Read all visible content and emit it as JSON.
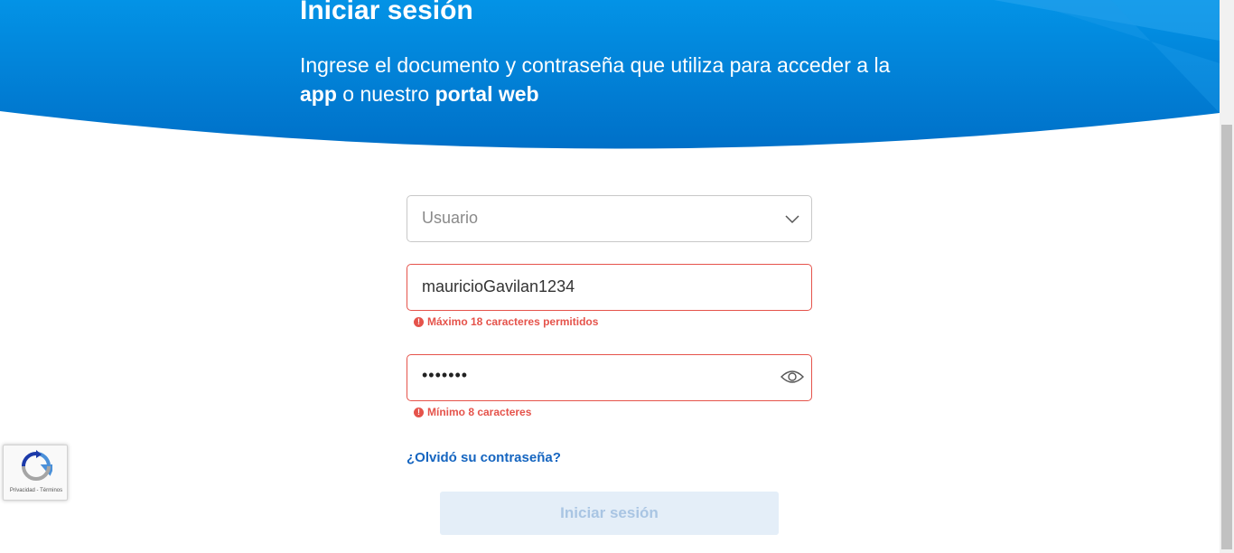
{
  "hero": {
    "title": "Iniciar sesión",
    "subtitle_part1": "Ingrese el documento y contraseña que utiliza para acceder a la ",
    "subtitle_bold1": "app",
    "subtitle_part2": " o nuestro ",
    "subtitle_bold2": "portal web"
  },
  "form": {
    "user_type_placeholder": "Usuario",
    "username_value": "mauricioGavilan1234",
    "username_error": "Máximo 18 caracteres permitidos",
    "password_masked": "•••••••",
    "password_error": "Mínimo 8 caracteres",
    "forgot_link": "¿Olvidó su contraseña?",
    "submit_label": "Iniciar sesión"
  },
  "recaptcha": {
    "legal": "Privacidad - Términos"
  },
  "colors": {
    "hero_blue": "#0277cf",
    "error": "#e5534b",
    "link": "#1565c0"
  },
  "icons": {
    "dropdown": "chevron-down-icon",
    "toggle_password": "eye-icon",
    "error": "exclamation-icon",
    "captcha": "recaptcha-logo-icon"
  }
}
